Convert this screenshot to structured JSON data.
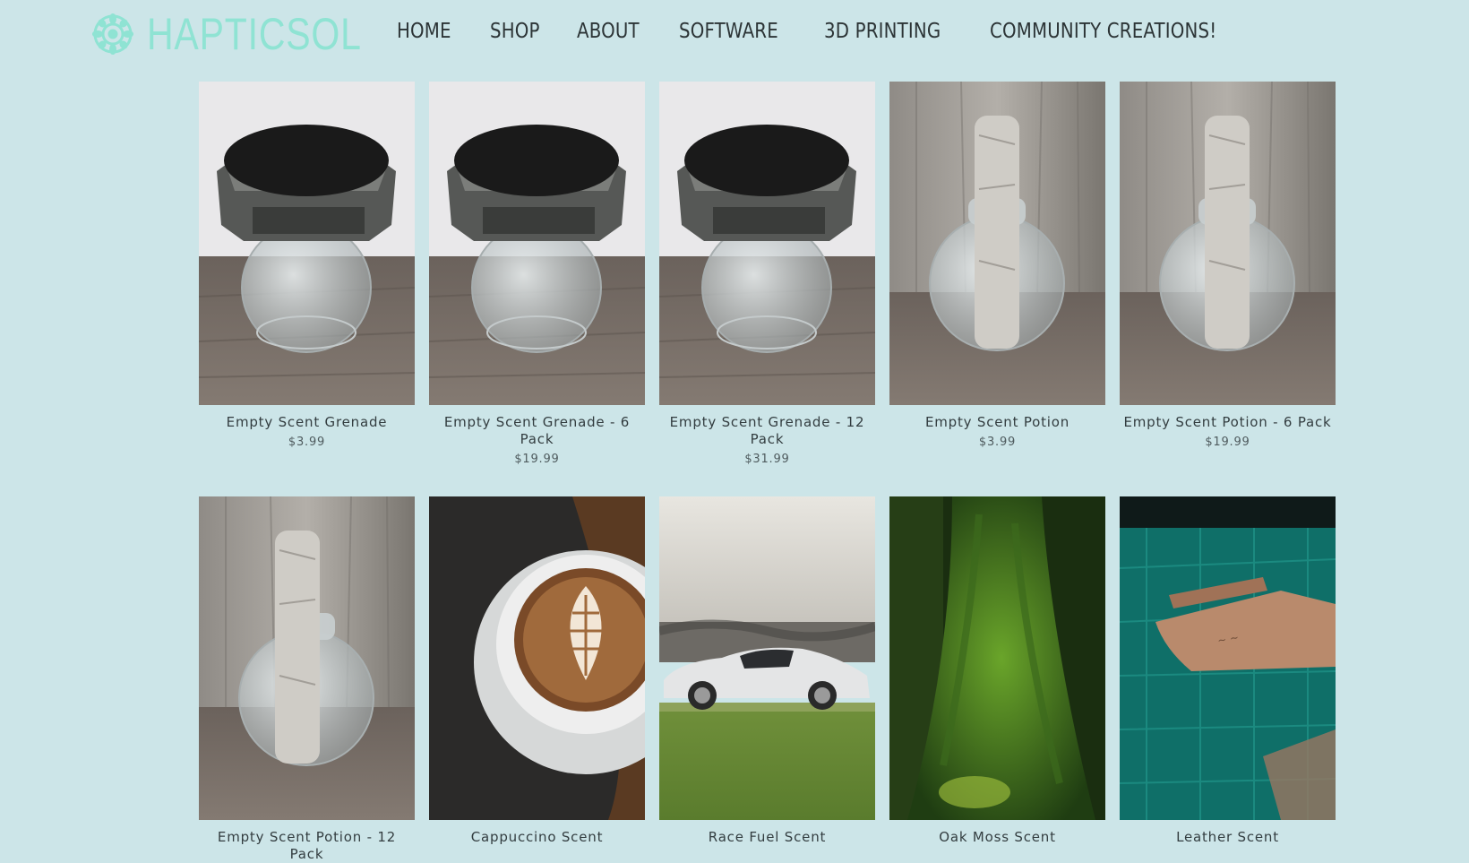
{
  "brand": {
    "name": "HAPTICSOL",
    "logo_icon": "flower-mandala-icon",
    "color": "#8fe3d3"
  },
  "nav": {
    "home": "HOME",
    "shop": "SHOP",
    "about": "ABOUT",
    "software": "SOFTWARE",
    "printing": "3D PRINTING",
    "community": "COMMUNITY CREATIONS!"
  },
  "products": [
    {
      "name": "Empty Scent Grenade",
      "price": "$3.99",
      "image": "grenade-jar"
    },
    {
      "name": "Empty Scent Grenade - 6 Pack",
      "price": "$19.99",
      "image": "grenade-jar"
    },
    {
      "name": "Empty Scent Grenade - 12 Pack",
      "price": "$31.99",
      "image": "grenade-jar"
    },
    {
      "name": "Empty Scent Potion",
      "price": "$3.99",
      "image": "potion-bottle"
    },
    {
      "name": "Empty Scent Potion - 6 Pack",
      "price": "$19.99",
      "image": "potion-bottle"
    },
    {
      "name": "Empty Scent Potion - 12 Pack",
      "image": "potion-bottle"
    },
    {
      "name": "Cappuccino Scent",
      "image": "coffee-cup"
    },
    {
      "name": "Race Fuel Scent",
      "image": "race-car"
    },
    {
      "name": "Oak Moss Scent",
      "image": "mossy-tree"
    },
    {
      "name": "Leather Scent",
      "image": "leather-mat"
    }
  ],
  "colors": {
    "background": "#cce5e8",
    "text": "#2f3a3c"
  }
}
